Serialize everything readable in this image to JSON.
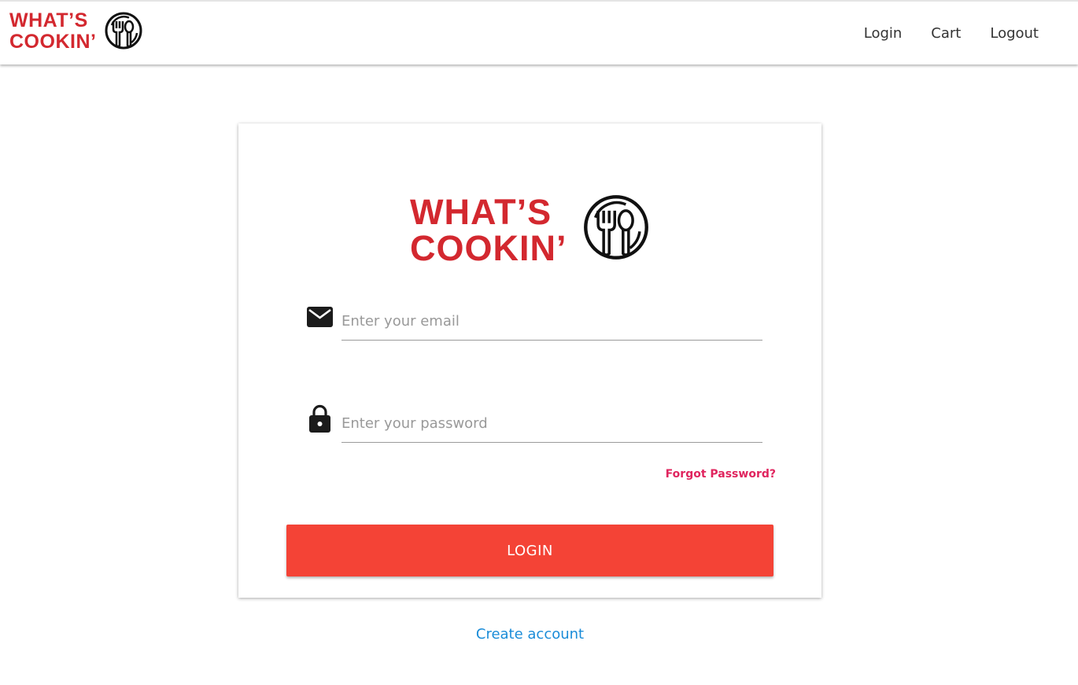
{
  "brand": {
    "line1": "WHAT’S",
    "line2": "COOKIN’",
    "color": "#d3282f",
    "icon": "plate-fork-spoon-icon"
  },
  "nav": {
    "links": [
      "Login",
      "Cart",
      "Logout"
    ]
  },
  "form": {
    "email_placeholder": "Enter your email",
    "email_icon": "envelope-icon",
    "password_placeholder": "Enter your password",
    "password_icon": "lock-icon",
    "forgot_label": "Forgot Password?",
    "login_label": "LOGIN",
    "login_color": "#f44336",
    "create_account_label": "Create account"
  }
}
